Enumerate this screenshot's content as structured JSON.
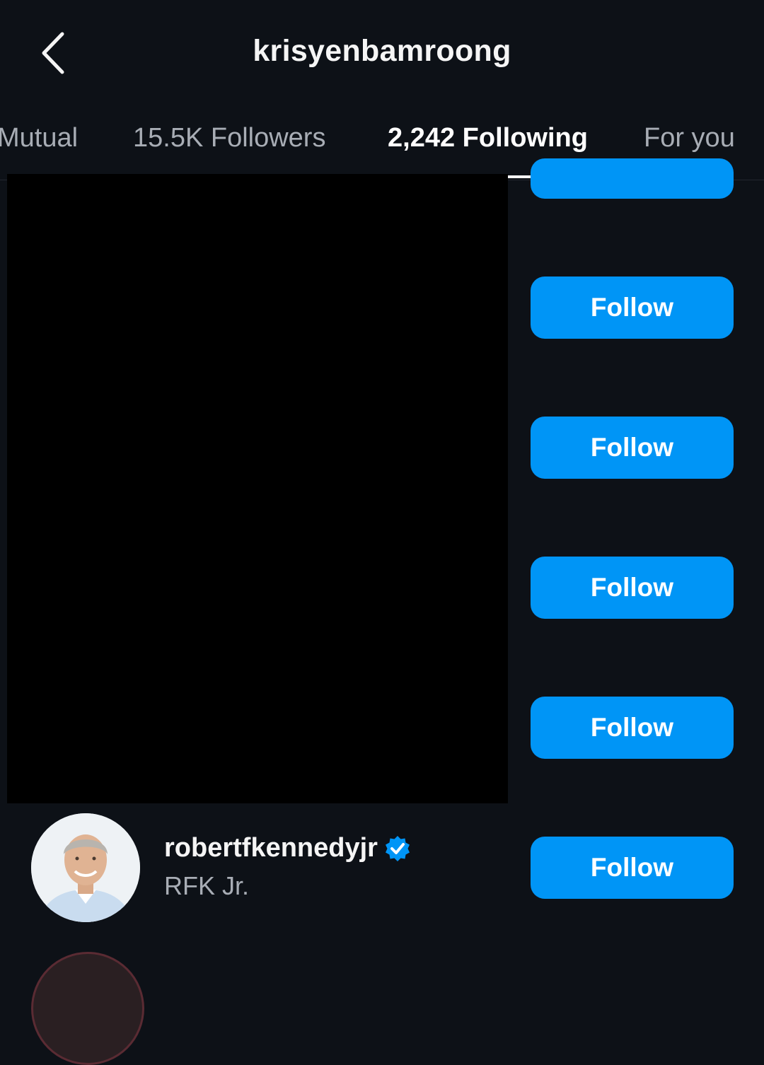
{
  "header": {
    "title": "krisyenbamroong",
    "back_icon": "chevron-left-icon"
  },
  "tabs": [
    {
      "label": "Mutual",
      "active": false
    },
    {
      "label": "15.5K Followers",
      "active": false
    },
    {
      "label": "2,242 Following",
      "active": true
    },
    {
      "label": "For you",
      "active": false
    }
  ],
  "list": {
    "follow_label": "Follow",
    "visible_user": {
      "username": "robertfkennedyjr",
      "full_name": "RFK Jr.",
      "verified": true,
      "verified_icon": "verified-badge-icon"
    }
  },
  "colors": {
    "background": "#0d1117",
    "follow_button": "#0095f6",
    "verified_badge": "#0095f6",
    "redaction": "#000000"
  }
}
